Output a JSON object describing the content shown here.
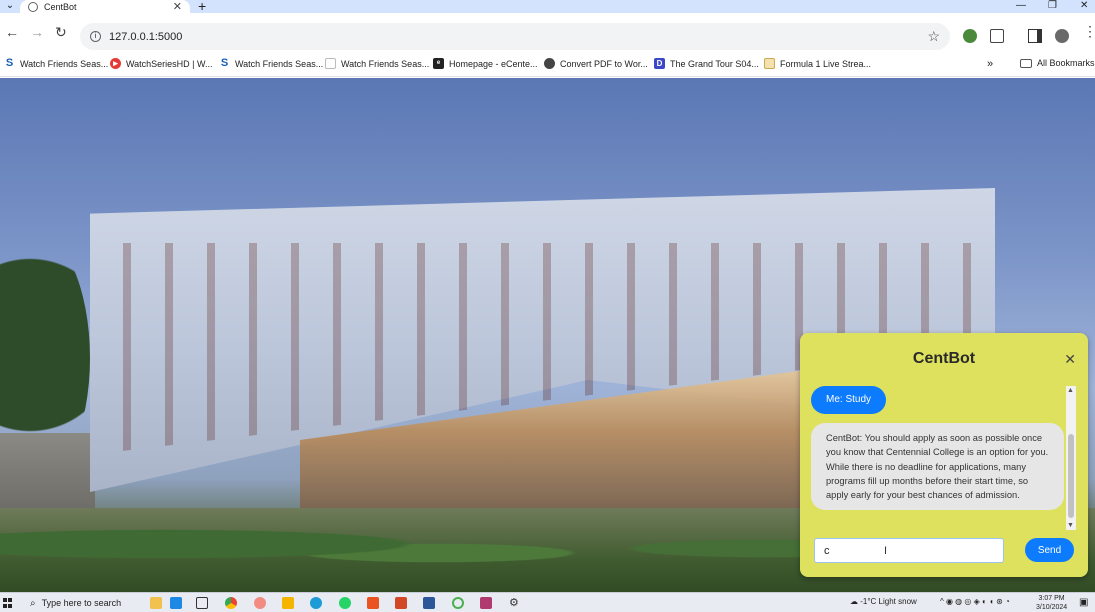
{
  "browser": {
    "tab_title": "CentBot",
    "url": "127.0.0.1:5000",
    "bookmarks": [
      "Watch Friends Seas...",
      "WatchSeriesHD | W...",
      "Watch Friends Seas...",
      "Watch Friends Seas...",
      "Homepage - eCente...",
      "Convert PDF to Wor...",
      "The Grand Tour S04...",
      "Formula 1 Live Strea..."
    ],
    "all_bookmarks": "All Bookmarks"
  },
  "chat": {
    "title": "CentBot",
    "user_message": "Me: Study",
    "bot_message": "CentBot: You should apply as soon as possible once you know that Centennial College is an option for you. While there is no deadline for applications, many programs fill up months before their start time, so apply early for your best chances of admission.",
    "input_value": "c",
    "send_label": "Send",
    "accent": "#0d7bfe",
    "panel_color": "#dde15d"
  },
  "taskbar": {
    "search_placeholder": "Type here to search",
    "weather": "-1°C  Light snow",
    "time": "3:07 PM",
    "date": "3/10/2024"
  }
}
